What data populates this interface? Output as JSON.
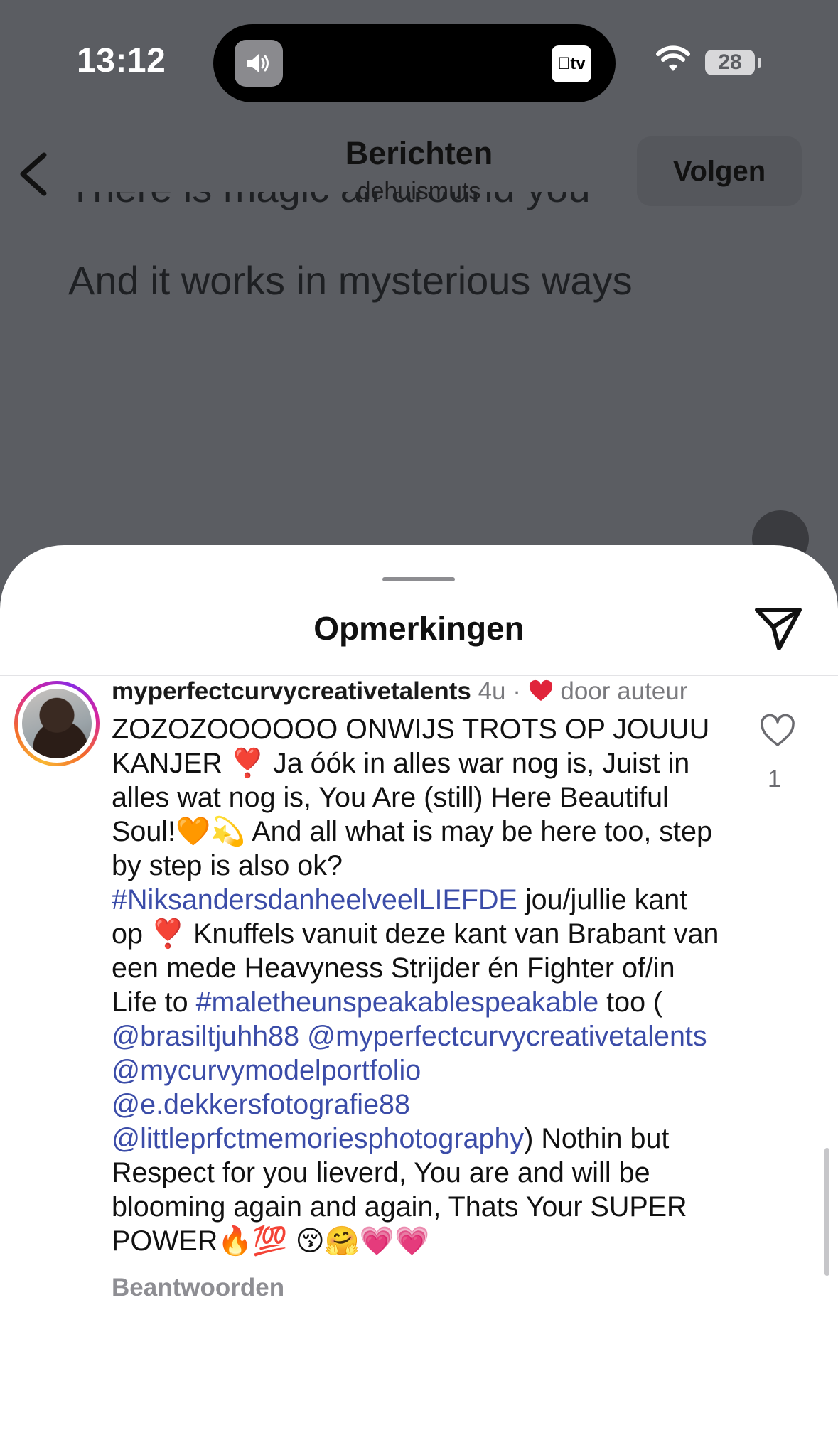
{
  "status_bar": {
    "time": "13:12",
    "battery": "28",
    "tv_label": "tv"
  },
  "nav": {
    "title": "Berichten",
    "subtitle": "dehuismuts",
    "follow_label": "Volgen"
  },
  "post": {
    "lyric_partial": "There is magic all around you",
    "lyric_line": "And it works in mysterious ways"
  },
  "sheet": {
    "title": "Opmerkingen"
  },
  "comment": {
    "username": "myperfectcurvycreativetalents",
    "time": "4u",
    "separator": "·",
    "liked_by_label": "door auteur",
    "text_1": "ZOZOZOOOOOO ONWIJS TROTS OP JOUUU KANJER ",
    "emoji_1": "❣️",
    "text_2": " Ja  óók in alles war nog is, Juist in alles wat nog is, You Are (still) Here Beautiful Soul!",
    "emoji_2": "🧡💫",
    "text_3": " And all what is may be here too, step by step is also ok? ",
    "tag_1": "#NiksandersdanheelveelLIEFDE",
    "text_4": " jou/jullie kant op ",
    "emoji_3": "❣️",
    "text_5": " Knuffels vanuit deze kant van Brabant van een mede Heavyness Strijder én Fighter of/in Life to ",
    "tag_2": "#maletheunspeakablespeakable",
    "text_6": " too ( ",
    "mention_1": "@brasiltjuhh88",
    "mention_2": "@myperfectcurvycreativetalents",
    "mention_3": "@mycurvymodelportfolio",
    "mention_4": "@e.dekkersfotografie88",
    "mention_5": "@littleprfctmemoriesphotography",
    "text_7": ") Nothin but Respect for you lieverd, You are and will be blooming again and again, Thats Your SUPER POWER",
    "emoji_4": "🔥💯 😚🤗💗💗",
    "reply_label": "Beantwoorden",
    "like_count": "1"
  }
}
